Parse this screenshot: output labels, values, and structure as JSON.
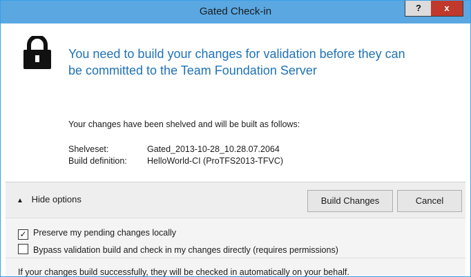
{
  "window": {
    "title": "Gated Check-in",
    "help_label": "?",
    "close_label": "x",
    "accent": "#5aa7e2"
  },
  "message": {
    "line1": "You need to build your changes for validation before they can",
    "line2": "be committed to the Team Foundation Server",
    "description": "Your changes have been shelved and will be built as follows:",
    "shelveset_label": "Shelveset:",
    "shelveset_value": "Gated_2013-10-28_10.28.07.2064",
    "build_label": "Build definition:",
    "build_value": "HelloWorld-CI (ProTFS2013-TFVC)"
  },
  "options": {
    "toggle_label": "Hide options",
    "build_button": "Build Changes",
    "cancel_button": "Cancel"
  },
  "checkboxes": [
    {
      "label": "Preserve my pending changes locally",
      "checked": true
    },
    {
      "label": "Bypass validation build and check in my changes directly (requires permissions)",
      "checked": false
    }
  ],
  "footer": {
    "text": "If your changes build successfully, they will be checked in automatically on your behalf."
  },
  "icons": {
    "lock": "lock-icon",
    "chevron": "chevron-up-icon"
  }
}
